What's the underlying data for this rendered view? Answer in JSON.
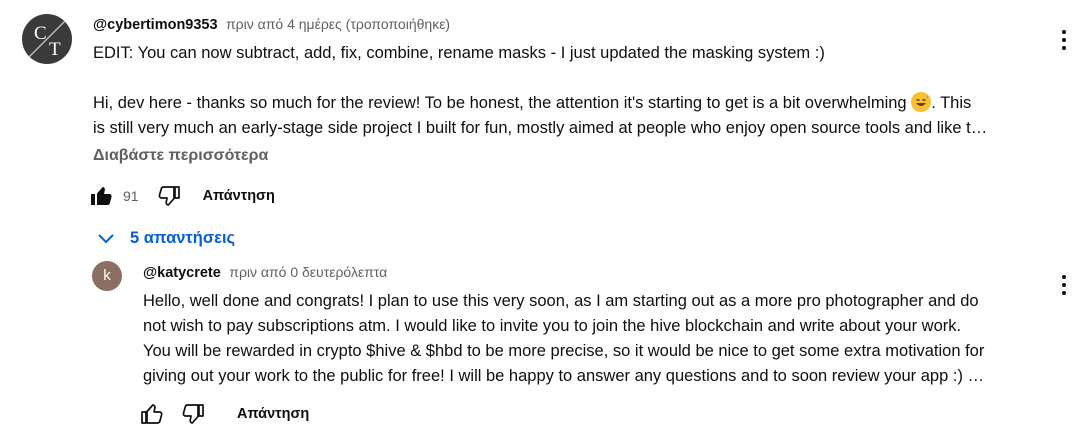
{
  "comment": {
    "author": "@cybertimon9353",
    "meta": "πριν από 4 ημέρες (τροποποιήθηκε)",
    "avatar_letters": "CT",
    "lines": [
      "EDIT: You can now subtract, add, fix, combine, rename masks - I just updated the masking system :)",
      "",
      "Hi, dev here - thanks so much for the review! To be honest, the attention it's starting to get is a bit overwhelming",
      "is still very much an early-stage side project I built for fun, mostly aimed at people who enjoy open source tools and like t…"
    ],
    "line3_tail": ". This",
    "read_more": "Διαβάστε περισσότερα",
    "likes": "91",
    "reply_label": "Απάντηση"
  },
  "replies": {
    "toggle_label": "5 απαντήσεις"
  },
  "reply": {
    "author": "@katycrete",
    "meta": "πριν από 0 δευτερόλεπτα",
    "avatar_letter": "k",
    "lines": [
      "Hello, well done and congrats! I plan to use this very soon, as I am starting out as a more pro photographer and do",
      "not wish to pay subscriptions atm. I would like to invite you to join the hive blockchain and write about your work.",
      "You will be rewarded in crypto $hive & $hbd to be more precise, so it would be nice to get some extra motivation for",
      "giving out your work to the public for free! I will be happy to answer any questions and to soon review your app :) …"
    ],
    "reply_label": "Απάντηση"
  },
  "icons": {
    "like": "thumbs-up-icon",
    "dislike": "thumbs-down-icon",
    "more": "more-vert-icon",
    "chevron": "chevron-down-icon",
    "emoji": "grinning-sweat-emoji"
  },
  "colors": {
    "link": "#065fd4",
    "meta": "#606060",
    "text": "#0f0f0f",
    "reply_avatar": "#8d6e63"
  }
}
